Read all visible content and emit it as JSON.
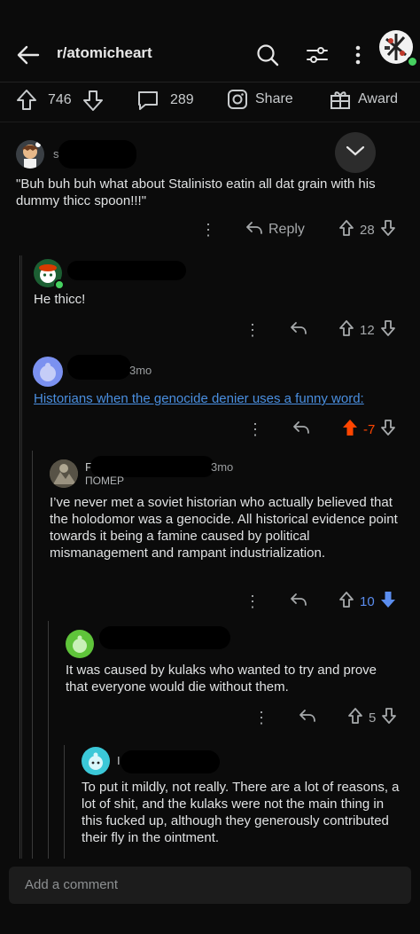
{
  "header": {
    "subreddit": "r/atomicheart",
    "back_icon": "arrow-left-icon",
    "search_icon": "search-icon",
    "filter_icon": "sliders-icon",
    "more_icon": "kebab-icon"
  },
  "post_actions": {
    "upvotes": "746",
    "comments": "289",
    "share": "Share",
    "award": "Award"
  },
  "comments": [
    {
      "author_initial": "s",
      "text": "\"Buh buh buh what about Stalinisto eatin all dat grain with his dummy thicc spoon!!!\"",
      "reply": "Reply",
      "score": "28"
    },
    {
      "text": "He thicc!",
      "score": "12"
    },
    {
      "age": "3mo",
      "text": "Historians when the genocide denier uses a funny word:",
      "score": "-7",
      "vote_color": "#ff4500"
    },
    {
      "author_initial": "F",
      "age": "3mo",
      "flair": "ПОМЕР",
      "text": "I’ve never met a soviet historian who actually believed that the holodomor was a genocide. All historical evidence point towards it being a famine caused by political mismanagement and rampant industrialization.",
      "score": "10",
      "vote_color": "#5b8def"
    },
    {
      "text": "It was caused by kulaks who wanted to try and prove that everyone would die without them.",
      "score": "5"
    },
    {
      "author_initial": "I",
      "text": "To put it mildly, not really. There are a lot of reasons, a lot of shit, and the kulaks were not the main thing in this fucked up, although they generously contributed their fly in the ointment."
    }
  ],
  "composer": {
    "placeholder": "Add a comment"
  },
  "colors": {
    "background": "#0b0b0b",
    "text": "#e0e2e3",
    "link": "#4a8fe0",
    "downvote": "#ff4500",
    "upvote_blue": "#5b8def"
  }
}
